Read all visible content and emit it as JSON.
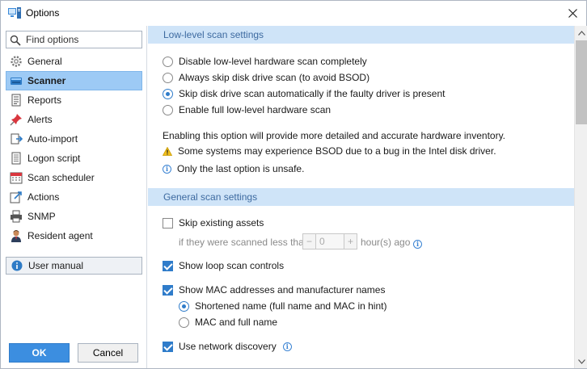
{
  "window": {
    "title": "Options"
  },
  "sidebar": {
    "search_placeholder": "Find options",
    "items": [
      {
        "label": "General",
        "icon": "gear-icon"
      },
      {
        "label": "Scanner",
        "icon": "scanner-icon",
        "selected": true
      },
      {
        "label": "Reports",
        "icon": "report-icon"
      },
      {
        "label": "Alerts",
        "icon": "pushpin-icon"
      },
      {
        "label": "Auto-import",
        "icon": "auto-import-icon"
      },
      {
        "label": "Logon script",
        "icon": "script-icon"
      },
      {
        "label": "Scan scheduler",
        "icon": "calendar-icon"
      },
      {
        "label": "Actions",
        "icon": "actions-icon"
      },
      {
        "label": "SNMP",
        "icon": "printer-icon"
      },
      {
        "label": "Resident agent",
        "icon": "person-icon"
      }
    ],
    "user_manual": "User manual",
    "ok": "OK",
    "cancel": "Cancel"
  },
  "lowlevel": {
    "header": "Low-level scan settings",
    "options": [
      {
        "label": "Disable low-level hardware scan completely",
        "checked": false
      },
      {
        "label": "Always skip disk drive scan (to avoid BSOD)",
        "checked": false
      },
      {
        "label": "Skip disk drive scan automatically if the faulty driver is present",
        "checked": true
      },
      {
        "label": "Enable full low-level hardware scan",
        "checked": false
      }
    ],
    "note": "Enabling this option will provide more detailed and accurate hardware inventory.",
    "warning": "Some systems may experience BSOD due to a bug in the Intel disk driver.",
    "info": "Only the last option is unsafe."
  },
  "general": {
    "header": "General scan settings",
    "skip_existing": "Skip existing assets",
    "scanned_prefix": "if they were scanned less than",
    "stepper_minus": "−",
    "stepper_value": "0",
    "stepper_plus": "+",
    "hours_suffix": "hour(s) ago",
    "show_loop": "Show loop scan controls",
    "show_mac": "Show MAC addresses and manufacturer names",
    "shortened": "Shortened name (full name and MAC in hint)",
    "mac_full": "MAC and full name",
    "network_discovery": "Use network discovery"
  },
  "colors": {
    "accent": "#2f7cca",
    "selected_bg": "#9dcaf5",
    "section_bg": "#cfe4f8",
    "section_text": "#3d6aa0"
  }
}
